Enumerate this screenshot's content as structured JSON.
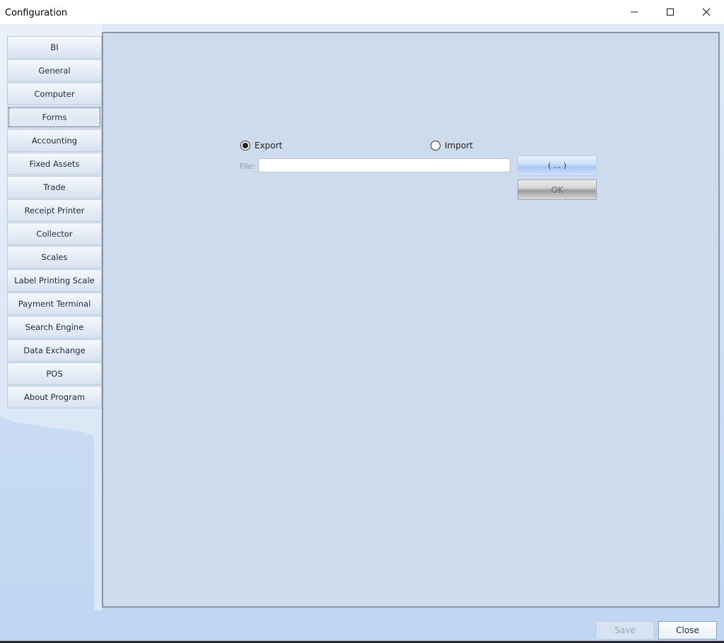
{
  "window": {
    "title": "Configuration"
  },
  "nav": {
    "items": [
      {
        "label": "BI"
      },
      {
        "label": "General"
      },
      {
        "label": "Computer"
      },
      {
        "label": "Forms",
        "active": true
      },
      {
        "label": "Accounting"
      },
      {
        "label": "Fixed Assets"
      },
      {
        "label": "Trade"
      },
      {
        "label": "Receipt Printer"
      },
      {
        "label": "Collector"
      },
      {
        "label": "Scales"
      },
      {
        "label": "Label Printing Scale"
      },
      {
        "label": "Payment Terminal"
      },
      {
        "label": "Search Engine"
      },
      {
        "label": "Data Exchange"
      },
      {
        "label": "POS"
      },
      {
        "label": "About Program"
      }
    ]
  },
  "form": {
    "export_label": "Export",
    "import_label": "Import",
    "selected_mode": "export",
    "file_label": "File:",
    "file_value": "",
    "browse_label": "( ... )",
    "ok_label": "OK"
  },
  "footer": {
    "save_label": "Save",
    "close_label": "Close"
  },
  "icons": {
    "minimize": "minimize-icon",
    "maximize": "maximize-icon",
    "close": "close-icon"
  }
}
